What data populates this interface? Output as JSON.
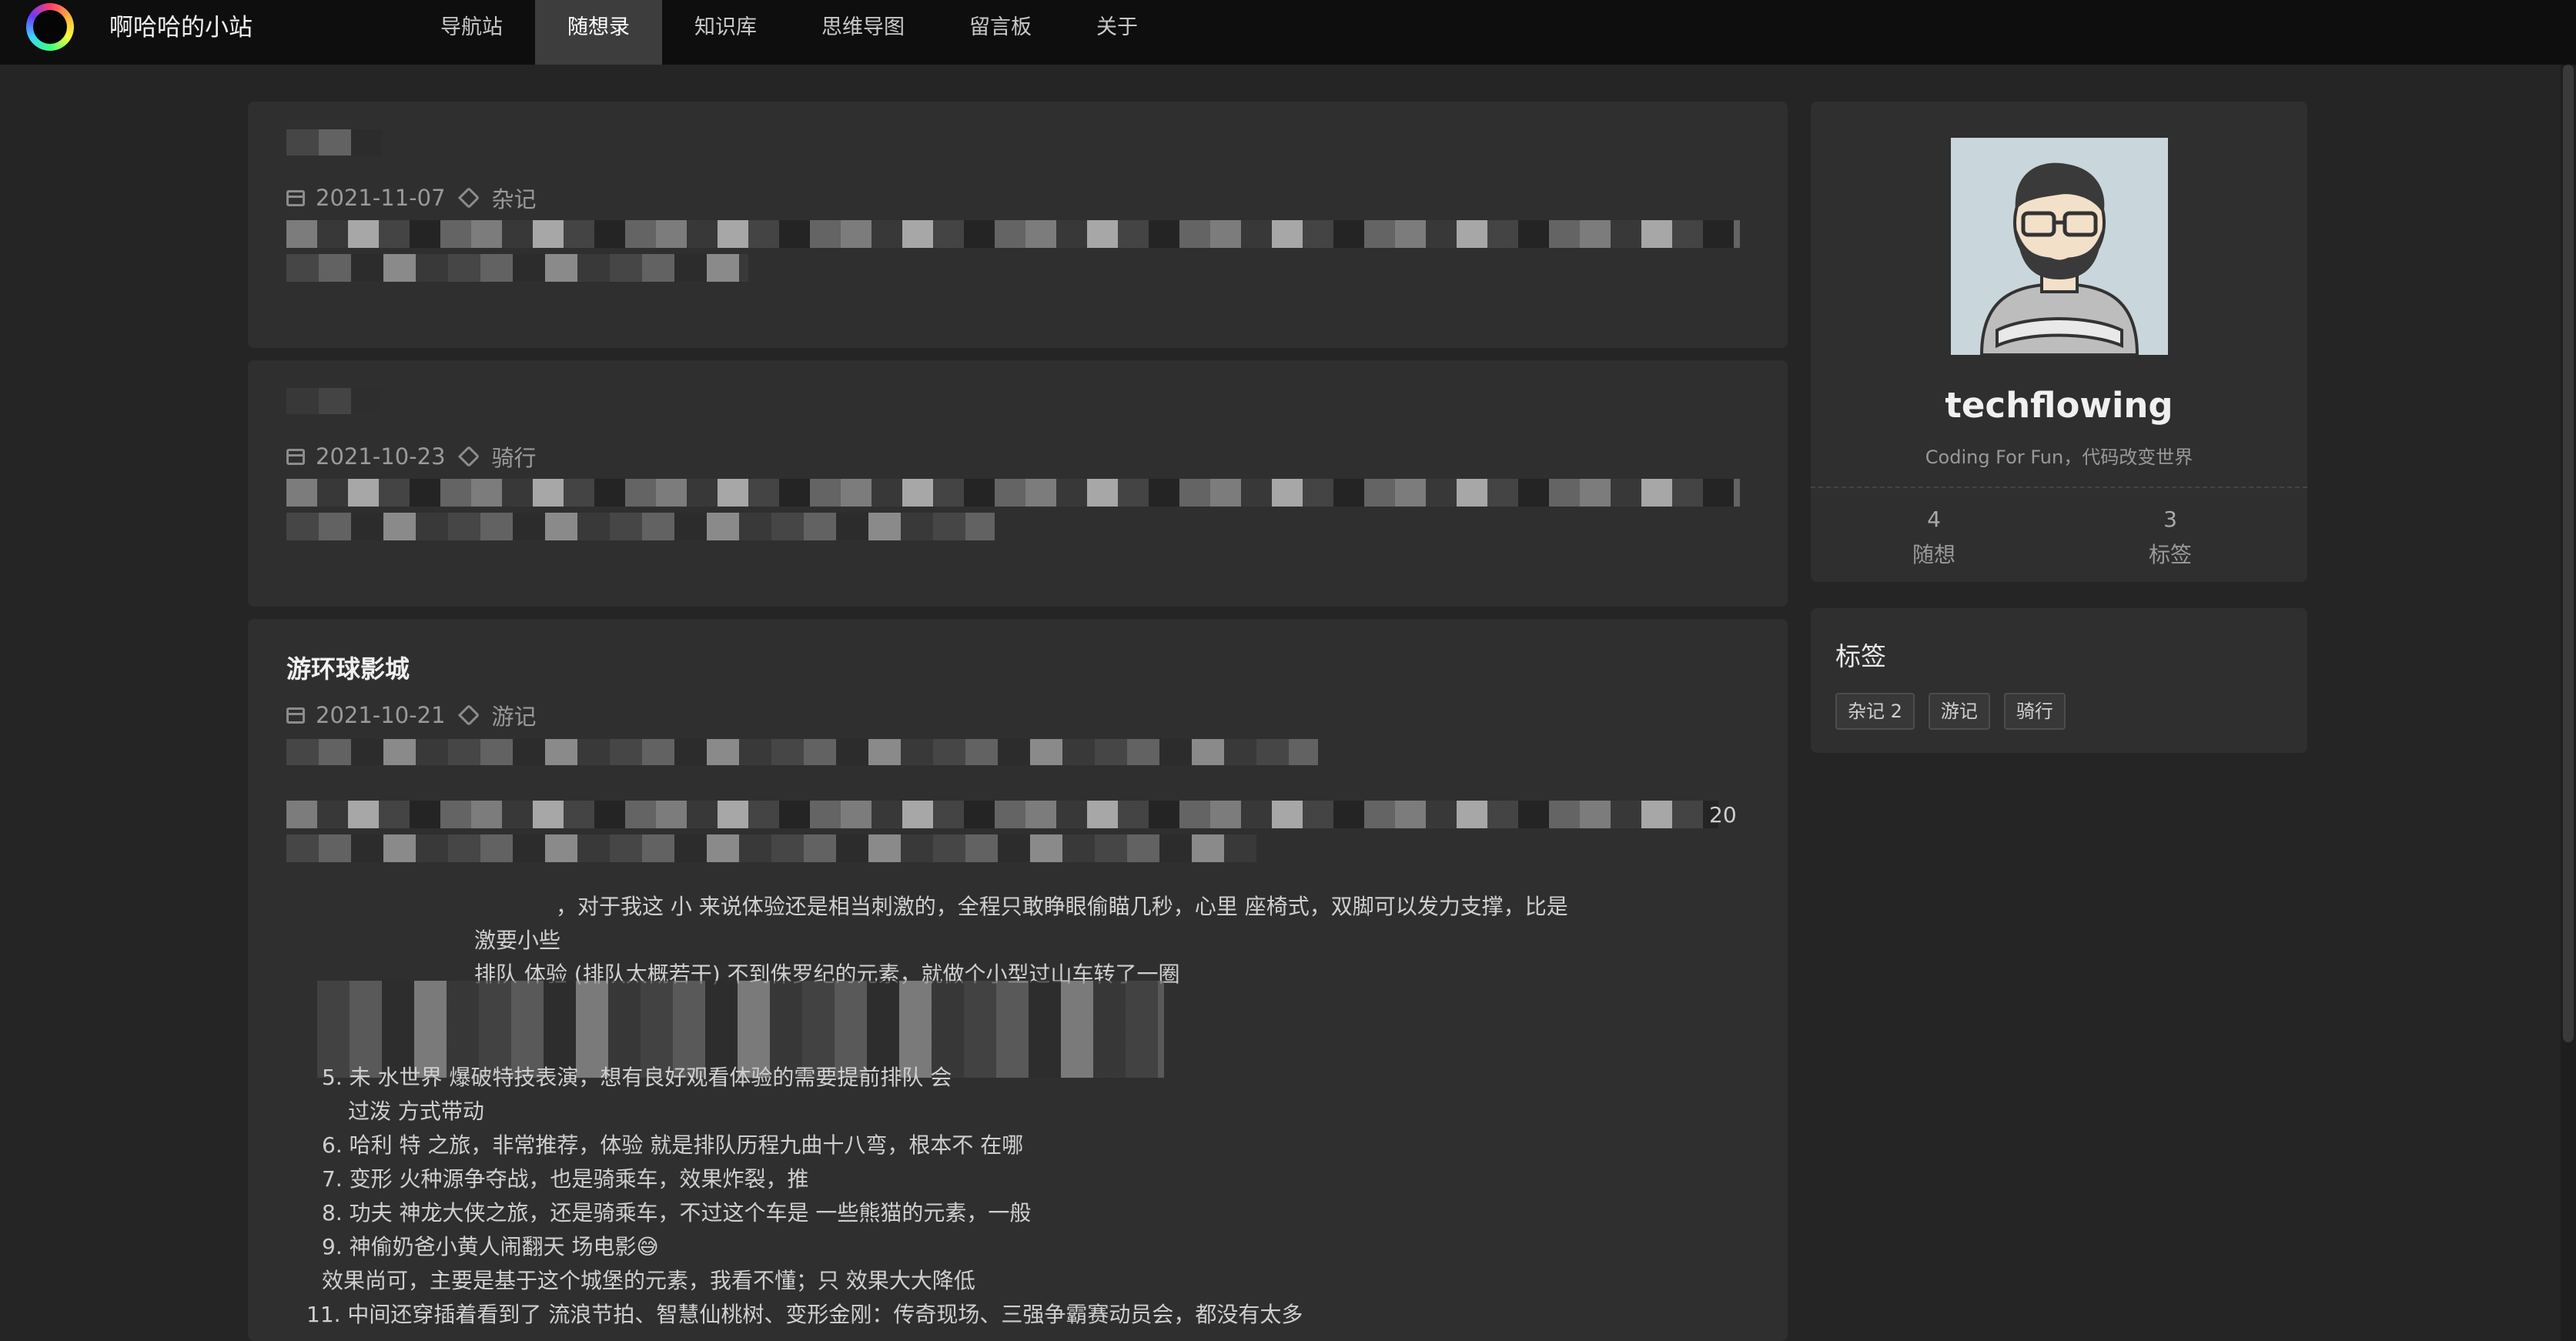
{
  "site": {
    "title": "啊哈哈的小站"
  },
  "nav": {
    "items": [
      {
        "label": "导航站"
      },
      {
        "label": "随想录"
      },
      {
        "label": "知识库"
      },
      {
        "label": "思维导图"
      },
      {
        "label": "留言板"
      },
      {
        "label": "关于"
      }
    ],
    "active": "随想录"
  },
  "posts": [
    {
      "title": "",
      "date": "2021-11-07",
      "tag": "杂记"
    },
    {
      "title": "",
      "date": "2021-10-23",
      "tag": "骑行"
    },
    {
      "title": "游环球影城",
      "date": "2021-10-21",
      "tag": "游记",
      "body": [
        "20",
        "，对于我这   小  来说体验还是相当刺激的，全程只敢睁眼偷瞄几秒，心里     座椅式，双脚可以发力支撑，比是",
        "激要小些",
        "排队   体验   (排队太概若干)   不到侏罗纪的元素，就做个小型过山车转了一圈",
        "5. 未     水世界      爆破特技表演，想有良好观看体验的需要提前排队       会",
        "过泼     方式带动",
        "6. 哈利    特    之旅，非常推荐，体验    就是排队历程九曲十八弯，根本不    在哪",
        "7. 变形    火种源争夺战，也是骑乘车，效果炸裂，推",
        "8. 功夫    神龙大侠之旅，还是骑乘车，不过这个车是    一些熊猫的元素，一般",
        "9. 神偷奶爸小黄人闹翻天    场电影😅",
        "效果尚可，主要是基于这个城堡的元素，我看不懂；只    效果大大降低",
        "11. 中间还穿插着看到了 流浪节拍、智慧仙桃树、变形金刚：传奇现场、三强争霸赛动员会，都没有太多"
      ]
    }
  ],
  "profile": {
    "username": "techflowing",
    "motto": "Coding For Fun，代码改变世界",
    "stats": [
      {
        "value": "4",
        "label": "随想"
      },
      {
        "value": "3",
        "label": "标签"
      }
    ]
  },
  "tags_card": {
    "title": "标签",
    "tags": [
      {
        "label": "杂记 2"
      },
      {
        "label": "游记"
      },
      {
        "label": "骑行"
      }
    ]
  }
}
